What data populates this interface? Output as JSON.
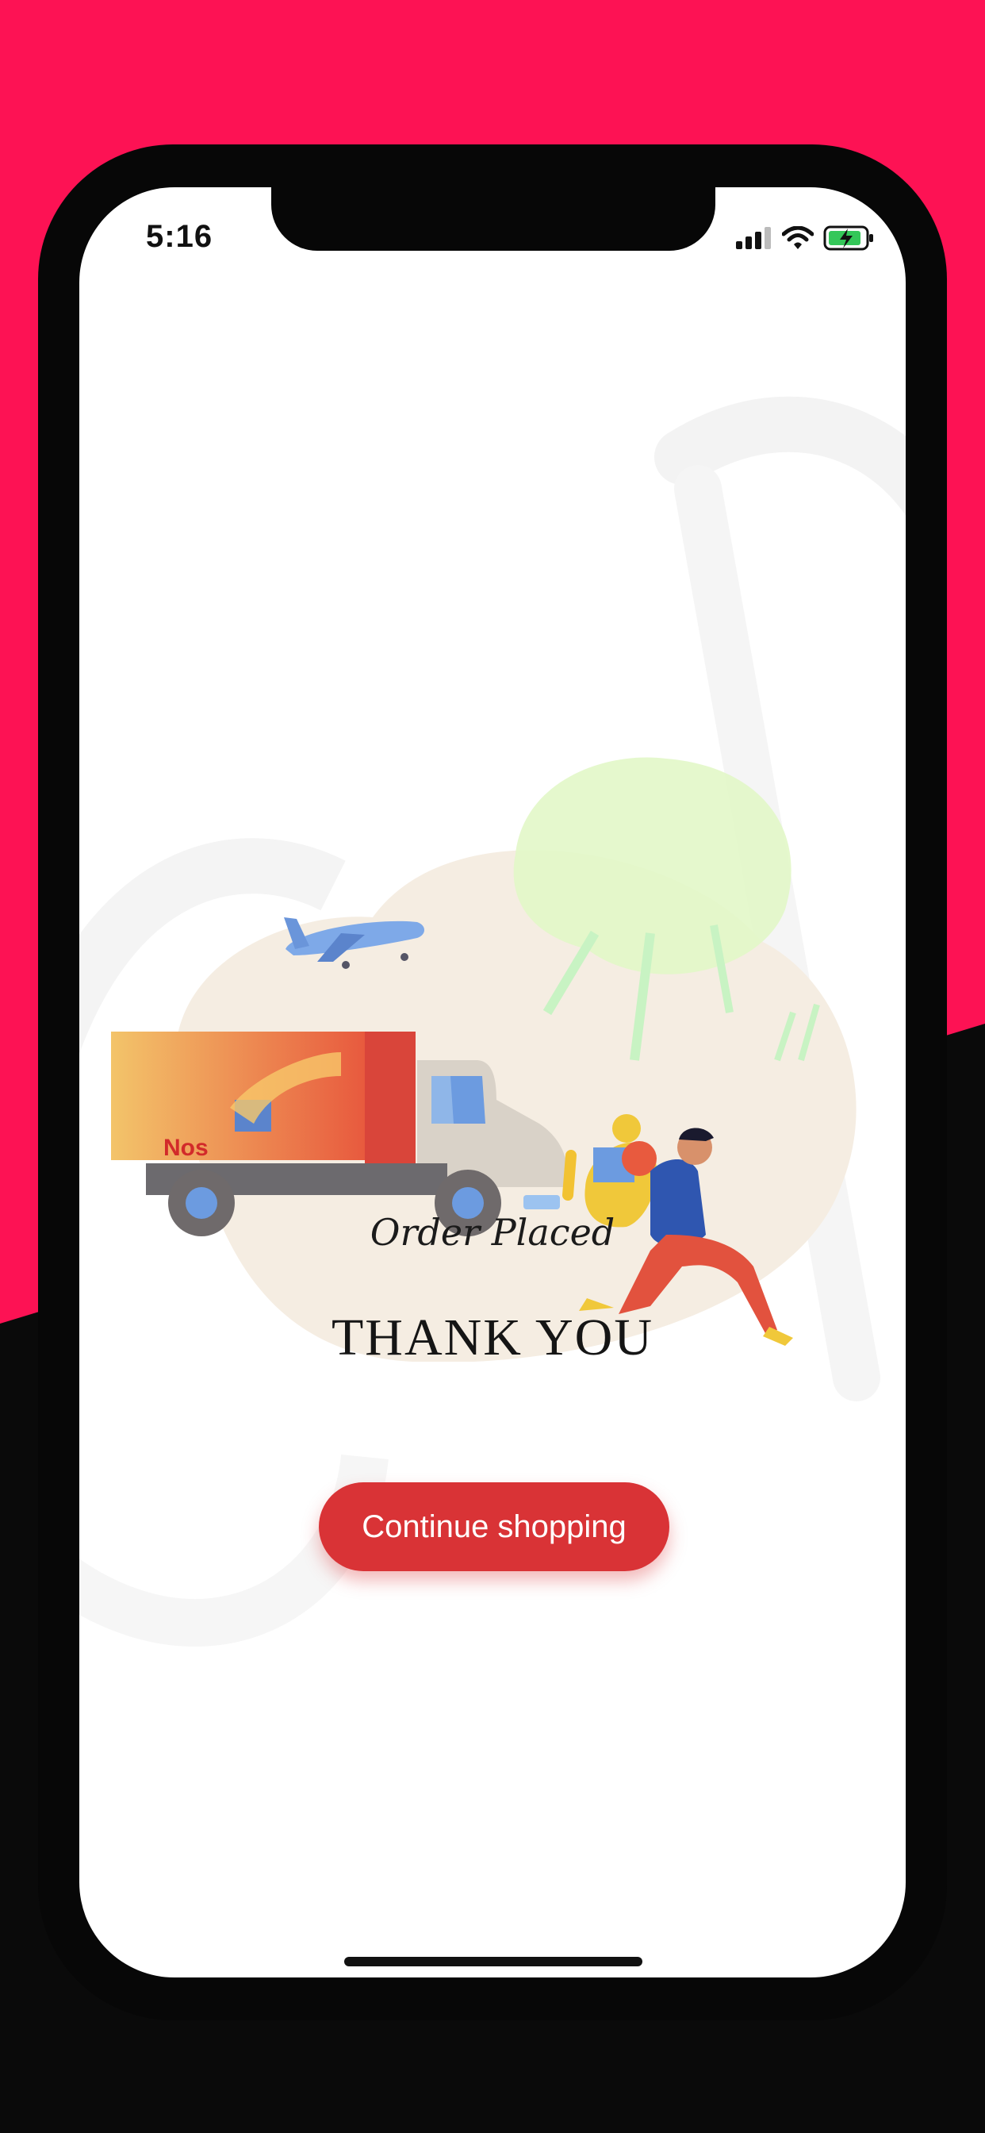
{
  "colors": {
    "brand_pink": "#fd1254",
    "accent_red": "#d93336",
    "frame": "#070707",
    "screen": "#ffffff"
  },
  "status_bar": {
    "time": "5:16",
    "icons": [
      "cellular-signal-icon",
      "wifi-icon",
      "battery-charging-icon"
    ]
  },
  "illustration": {
    "truck_logo_text": "Nos",
    "elements": [
      "airplane",
      "delivery-truck",
      "tree",
      "courier-with-gifts"
    ]
  },
  "order_status": "Order Placed",
  "headline": "THANK YOU",
  "continue_button": {
    "label": "Continue shopping"
  }
}
